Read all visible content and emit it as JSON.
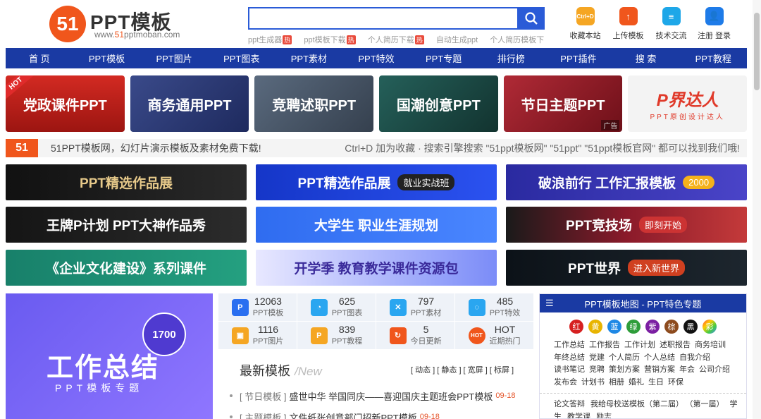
{
  "logo": {
    "mark": "51",
    "name": "PPT模板",
    "url_prefix": "www.",
    "url_brand": "51",
    "url_suffix": "pptmoban.com"
  },
  "search": {
    "value": "",
    "placeholder": ""
  },
  "hot_links": [
    {
      "label": "ppt生成器",
      "badge": "热"
    },
    {
      "label": "ppt模板下载",
      "badge": "热"
    },
    {
      "label": "个人简历下载",
      "badge": "热"
    },
    {
      "label": "自动生成ppt",
      "badge": ""
    },
    {
      "label": "个人简历模板下载",
      "badge": ""
    }
  ],
  "top_icons": [
    {
      "label": "收藏本站",
      "glyph": "Ctrl+D",
      "color": "#f5a623"
    },
    {
      "label": "上传模板",
      "glyph": "↑",
      "color": "#f0561c"
    },
    {
      "label": "技术交流",
      "glyph": "≡",
      "color": "#1ea7e8"
    },
    {
      "label": "注册 登录",
      "glyph": "👤",
      "color": "#1e7be8"
    }
  ],
  "nav": [
    "首 页",
    "PPT模板",
    "PPT图片",
    "PPT图表",
    "PPT素材",
    "PPT特效",
    "PPT专题",
    "排行榜",
    "PPT插件",
    "搜 索",
    "PPT教程"
  ],
  "categories": [
    {
      "label": "党政课件PPT",
      "bg": "#c8201e",
      "hot": "HOT",
      "ad": ""
    },
    {
      "label": "商务通用PPT",
      "bg": "#2a3a78",
      "hot": "",
      "ad": ""
    },
    {
      "label": "竞聘述职PPT",
      "bg": "#4a5a6e",
      "hot": "",
      "ad": ""
    },
    {
      "label": "国潮创意PPT",
      "bg": "#1d4d4a",
      "hot": "",
      "ad": ""
    },
    {
      "label": "节日主题PPT",
      "bg": "#9a1e2a",
      "hot": "",
      "ad": "广告"
    },
    {
      "label": "P界达人",
      "bg": "#f3f3f3",
      "hot": "",
      "ad": ""
    }
  ],
  "category_extra": "PPT原创设计达人",
  "slogan": {
    "mark": "51",
    "left": "51PPT模板网，幻灯片演示模板及素材免费下载!",
    "right": "Ctrl+D 加为收藏 · 搜索引擎搜索 \"51ppt模板网\" \"51ppt\" \"51ppt模板官网\" 都可以找到我们哦!"
  },
  "ads": [
    {
      "title": "PPT精选作品展",
      "tag": "",
      "bg": "#1a1a1a",
      "tag_bg": ""
    },
    {
      "title": "PPT精选作品展",
      "tag": "就业实战班",
      "bg": "#1b3bd1",
      "tag_bg": "#333"
    },
    {
      "title": "破浪前行 工作汇报模板",
      "tag": "2000",
      "bg": "#3a3ab0",
      "tag_bg": "#f5b21b"
    },
    {
      "title": "王牌P计划 PPT大神作品秀",
      "tag": "",
      "bg": "#1a1a1a",
      "tag_bg": ""
    },
    {
      "title": "大学生 职业生涯规划",
      "tag": "",
      "bg": "#2f6cf0",
      "tag_bg": ""
    },
    {
      "title": "PPT竞技场",
      "tag": "即刻开始",
      "bg": "#9a1a2a",
      "tag_bg": "#c33"
    },
    {
      "title": "《企业文化建设》系列课件",
      "tag": "",
      "bg": "#1e8a6a",
      "tag_bg": ""
    },
    {
      "title": "开学季 教育教学课件资源包",
      "tag": "",
      "bg": "#6b7ff5",
      "tag_bg": ""
    },
    {
      "title": "PPT世界",
      "tag": "进入新世界",
      "bg": "#10161e",
      "tag_bg": "#d04020"
    }
  ],
  "feature": {
    "badge": "1700",
    "title": "工作总结",
    "subtitle": "PPT模板专题"
  },
  "stats": [
    {
      "num": "12063",
      "label": "PPT模板",
      "glyph": "P",
      "color": "#2a6ff0"
    },
    {
      "num": "625",
      "label": "PPT图表",
      "glyph": "◔",
      "color": "#2aa6f0"
    },
    {
      "num": "797",
      "label": "PPT素材",
      "glyph": "✕",
      "color": "#2aa6f0"
    },
    {
      "num": "485",
      "label": "PPT特效",
      "glyph": "◌",
      "color": "#2aa6f0"
    },
    {
      "num": "1116",
      "label": "PPT图片",
      "glyph": "▣",
      "color": "#f5a623"
    },
    {
      "num": "839",
      "label": "PPT教程",
      "glyph": "P",
      "color": "#f5a623"
    },
    {
      "num": "5",
      "label": "今日更新",
      "glyph": "↻",
      "color": "#f0561c"
    },
    {
      "num": "HOT",
      "label": "近期热门",
      "glyph": "HOT",
      "color": "#f0561c"
    }
  ],
  "latest": {
    "title": "最新模板",
    "title_en": "/New",
    "tabs": "[ 动态 ] [ 静态 ] [ 宽屏 ] [ 标屏 ]",
    "items": [
      {
        "cat": "[ 节日模板 ]",
        "title": "盛世中华 举国同庆——喜迎国庆主题班会PPT模板",
        "date": "09-18"
      },
      {
        "cat": "[ 主题模板 ]",
        "title": "文件纸张创意部门招新PPT模板",
        "date": "09-18"
      }
    ]
  },
  "map": {
    "title": "PPT模板地图 - PPT特色专题",
    "colors": [
      {
        "label": "红",
        "color": "#d62020"
      },
      {
        "label": "黄",
        "color": "#e8b400"
      },
      {
        "label": "蓝",
        "color": "#1e88e5"
      },
      {
        "label": "绿",
        "color": "#2e9d3a"
      },
      {
        "label": "紫",
        "color": "#7b1fa2"
      },
      {
        "label": "棕",
        "color": "#8d4b1e"
      },
      {
        "label": "黑",
        "color": "#111111"
      },
      {
        "label": "彩",
        "color": "#e040a0"
      }
    ],
    "tags": [
      "工作总结",
      "工作报告",
      "工作计划",
      "述职报告",
      "商务培训",
      "年终总结",
      "党建",
      "个人简历",
      "个人总结",
      "自我介绍",
      "读书笔记",
      "竞聘",
      "策划方案",
      "营销方案",
      "年会",
      "公司介绍",
      "发布会",
      "计划书",
      "相册",
      "婚礼",
      "生日",
      "环保"
    ],
    "tags2": [
      "论文答辩",
      "我给母校送模板（第二届）",
      "（第一届）",
      "学生",
      "教学课",
      "励志"
    ]
  }
}
